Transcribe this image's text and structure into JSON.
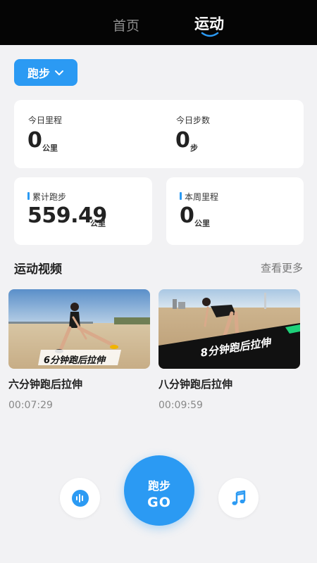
{
  "header": {
    "tabs": [
      {
        "label": "首页",
        "active": false
      },
      {
        "label": "运动",
        "active": true
      }
    ]
  },
  "filter": {
    "selected": "跑步"
  },
  "today": {
    "distance_label": "今日里程",
    "distance_value": "0",
    "distance_unit": "公里",
    "steps_label": "今日步数",
    "steps_value": "0",
    "steps_unit": "步"
  },
  "total_run": {
    "label": "累计跑步",
    "value": "559.49",
    "unit": "公里"
  },
  "week_distance": {
    "label": "本周里程",
    "value": "0",
    "unit": "公里"
  },
  "videos_section": {
    "title": "运动视频",
    "more": "查看更多",
    "items": [
      {
        "title": "六分钟跑后拉伸",
        "duration": "00:07:29",
        "overlay": "6分钟跑后拉伸"
      },
      {
        "title": "八分钟跑后拉伸",
        "duration": "00:09:59",
        "overlay": "8分钟跑后拉伸"
      }
    ]
  },
  "bottom": {
    "go_line1": "跑步",
    "go_line2": "GO",
    "left_icon": "audio-icon",
    "right_icon": "music-note-icon"
  },
  "colors": {
    "accent": "#2b9af3",
    "topbar": "#050505",
    "background": "#f2f2f4"
  }
}
